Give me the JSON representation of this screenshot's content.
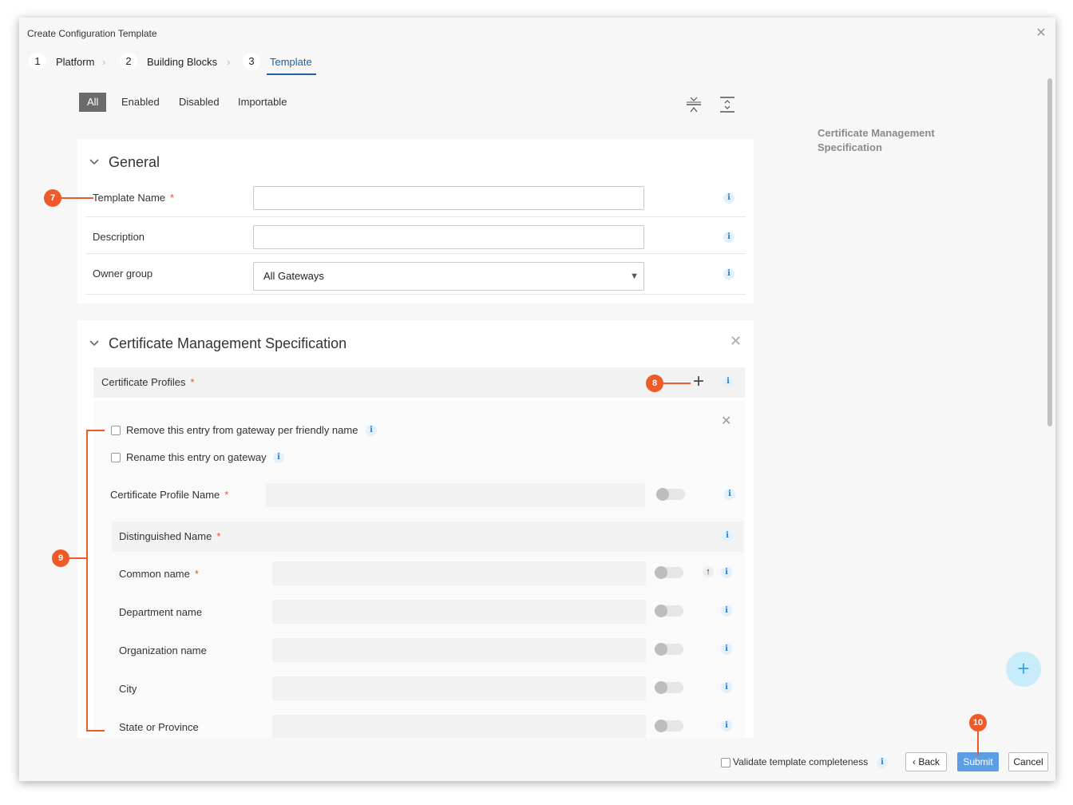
{
  "dialog": {
    "title": "Create Configuration Template",
    "close_icon": "close-icon"
  },
  "steps": [
    {
      "number": "1",
      "label": "Platform"
    },
    {
      "number": "2",
      "label": "Building Blocks"
    },
    {
      "number": "3",
      "label": "Template"
    }
  ],
  "filters": {
    "all": "All",
    "enabled": "Enabled",
    "disabled": "Disabled",
    "importable": "Importable"
  },
  "toolbar_icons": [
    "collapse-all-icon",
    "expand-all-icon"
  ],
  "sidebar": {
    "nav_link": "Certificate Management Specification"
  },
  "general": {
    "title": "General",
    "template_name_label": "Template Name",
    "template_name_value": "",
    "description_label": "Description",
    "description_value": "",
    "owner_group_label": "Owner group",
    "owner_group_value": "All Gateways",
    "required_mark": "*"
  },
  "cert_spec": {
    "title": "Certificate Management Specification",
    "profiles_label": "Certificate Profiles",
    "remove_entry_label": "Remove this entry from gateway per friendly name",
    "rename_entry_label": "Rename this entry on gateway",
    "profile_name_label": "Certificate Profile Name",
    "distinguished_name_label": "Distinguished Name",
    "fields": [
      {
        "label": "Common name",
        "required": true
      },
      {
        "label": "Department name",
        "required": false
      },
      {
        "label": "Organization name",
        "required": false
      },
      {
        "label": "City",
        "required": false
      },
      {
        "label": "State or Province",
        "required": false
      }
    ]
  },
  "callouts": {
    "c7": "7",
    "c8": "8",
    "c9": "9",
    "c10": "10"
  },
  "footer": {
    "validate_label": "Validate template completeness",
    "back": "Back",
    "submit": "Submit",
    "cancel": "Cancel"
  },
  "colors": {
    "accent": "#1f5fa8",
    "primary_button": "#5b9ee6",
    "callout": "#f05a28",
    "required": "#e5533c",
    "info": "#2a7fd0"
  }
}
